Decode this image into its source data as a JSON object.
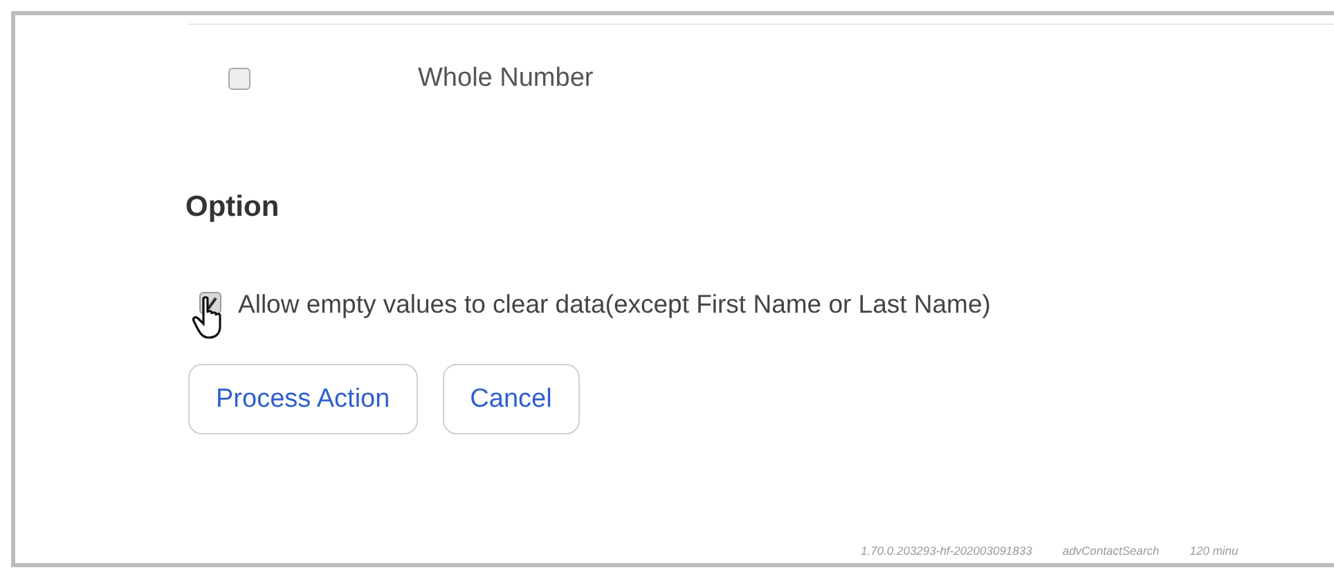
{
  "field_row": {
    "label": "Whole Number",
    "checked": false
  },
  "option": {
    "heading": "Option",
    "label": "Allow empty values to clear data(except First Name or Last Name)",
    "checked": true
  },
  "buttons": [
    "Process Action",
    "Cancel"
  ],
  "footer": [
    "1.70.0.203293-hf-202003091833",
    "advContactSearch",
    "120 minu"
  ]
}
